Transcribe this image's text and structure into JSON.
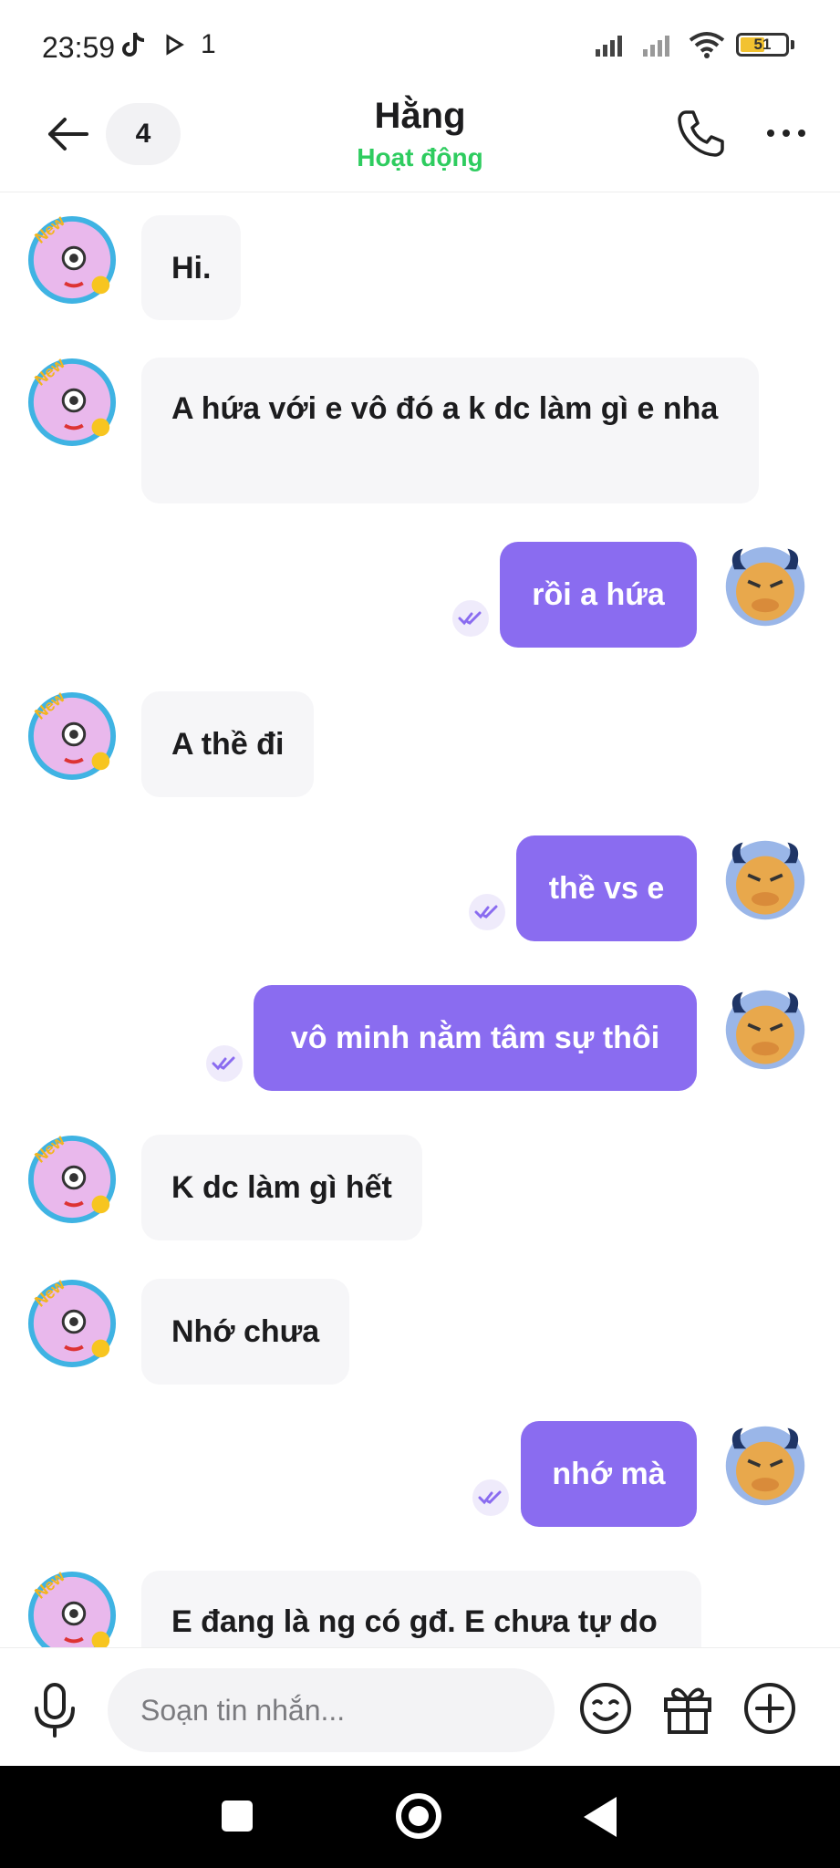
{
  "status_bar": {
    "time": "23:59",
    "notification_count": "1",
    "battery": "51"
  },
  "header": {
    "unread_count": "4",
    "title": "Hằng",
    "status": "Hoạt động",
    "status_color": "#2ecc5f"
  },
  "messages": [
    {
      "direction": "in",
      "text": "Hi."
    },
    {
      "direction": "in",
      "text": "A hứa với e vô đó a k dc làm gì e nha"
    },
    {
      "direction": "out",
      "text": "rồi a hứa",
      "seen": true
    },
    {
      "direction": "in",
      "text": "A thề đi"
    },
    {
      "direction": "out",
      "text": "thề vs e",
      "seen": true
    },
    {
      "direction": "out",
      "text": "vô minh nằm tâm sự thôi",
      "seen": true
    },
    {
      "direction": "in",
      "text": "K dc làm gì hết"
    },
    {
      "direction": "in",
      "text": "Nhớ chưa"
    },
    {
      "direction": "out",
      "text": "nhớ mà",
      "seen": true
    },
    {
      "direction": "in",
      "text": "E đang là ng có gđ. E chưa tự do"
    }
  ],
  "composer": {
    "placeholder": "Soạn tin nhắn..."
  },
  "colors": {
    "outgoing_bubble": "#8a6cf0",
    "incoming_bubble": "#f6f6f8",
    "accent": "#8a6cf0"
  },
  "icons": [
    "back-arrow-icon",
    "phone-icon",
    "more-icon",
    "microphone-icon",
    "emoji-icon",
    "gift-icon",
    "plus-icon",
    "seen-check-icon"
  ]
}
